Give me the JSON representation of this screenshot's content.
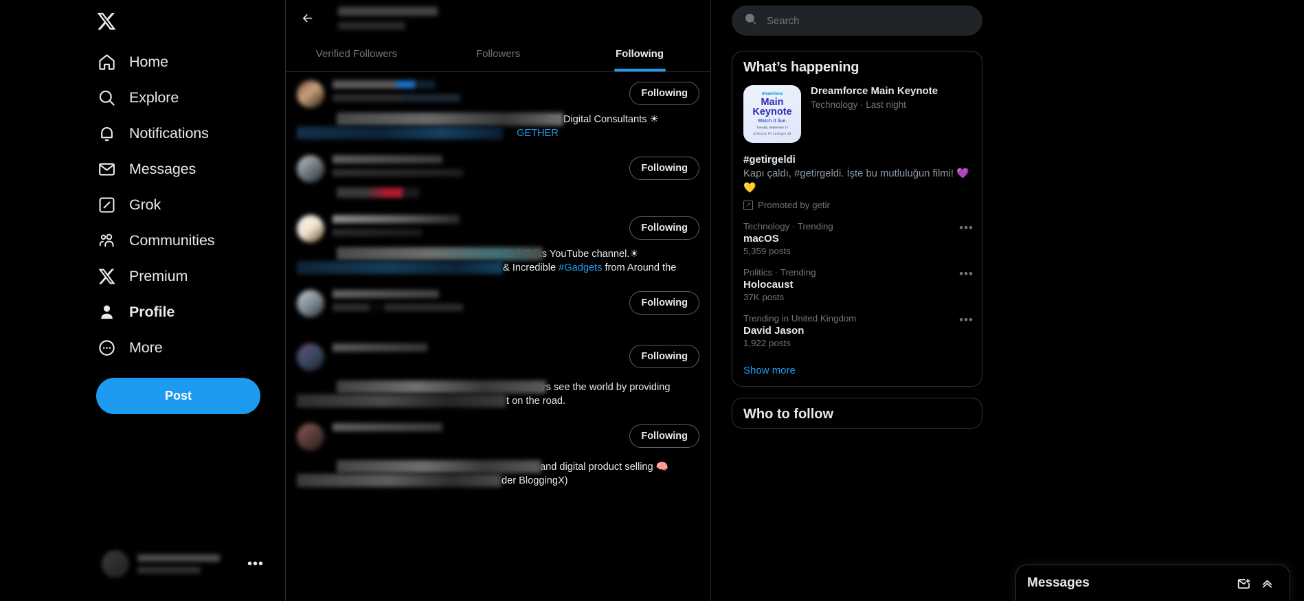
{
  "sidebar": {
    "logo_icon": "x-logo-icon",
    "items": [
      {
        "label": "Home",
        "icon": "home-icon",
        "active": false
      },
      {
        "label": "Explore",
        "icon": "search-icon",
        "active": false
      },
      {
        "label": "Notifications",
        "icon": "bell-icon",
        "active": false
      },
      {
        "label": "Messages",
        "icon": "envelope-icon",
        "active": false
      },
      {
        "label": "Grok",
        "icon": "grok-icon",
        "active": false
      },
      {
        "label": "Communities",
        "icon": "communities-icon",
        "active": false
      },
      {
        "label": "Premium",
        "icon": "x-logo-icon",
        "active": false
      },
      {
        "label": "Profile",
        "icon": "person-icon",
        "active": true
      },
      {
        "label": "More",
        "icon": "more-circle-icon",
        "active": false
      }
    ],
    "post_button": "Post",
    "account_more_icon": "ellipsis-icon"
  },
  "center": {
    "back_icon": "back-arrow-icon",
    "tabs": [
      {
        "label": "Verified Followers",
        "active": false
      },
      {
        "label": "Followers",
        "active": false
      },
      {
        "label": "Following",
        "active": true
      }
    ],
    "follow_button_label": "Following",
    "rows": [
      {
        "bio_visible": "ion - ☀ SP Digital Consultants ☀",
        "bio_visible2": "GETHER",
        "bio_mask_w": 330,
        "bio_mask_w2": 300,
        "name_w": 150,
        "handle_w": 186,
        "has_badge": true
      },
      {
        "bio_visible": "",
        "bio_visible2": "",
        "bio_mask_w": 0,
        "bio_mask_w2": 0,
        "name_w": 160,
        "handle_w": 190,
        "has_badge": false
      },
      {
        "bio_visible": " TechTalks YouTube channel.☀",
        "bio_visible2": "& Incredible #Gadgets from Around the",
        "bio_mask_w": 300,
        "bio_mask_w2": 300,
        "name_w": 185,
        "handle_w": 130,
        "has_badge": false
      },
      {
        "bio_visible": "",
        "bio_visible2": "",
        "bio_mask_w": 0,
        "bio_mask_w2": 0,
        "name_w": 155,
        "handle_w": 190,
        "has_badge": false
      },
      {
        "bio_visible": "r travelers see the world by providing",
        "bio_visible2": "t on the road.",
        "bio_mask_w": 305,
        "bio_mask_w2": 305,
        "name_w": 138,
        "handle_w": 0,
        "has_badge": false
      },
      {
        "bio_visible": "creation and digital product selling 🧠",
        "bio_visible2": "der BloggingX)",
        "bio_mask_w": 298,
        "bio_mask_w2": 298,
        "name_w": 160,
        "handle_w": 0,
        "has_badge": false
      }
    ]
  },
  "right": {
    "search": {
      "placeholder": "Search",
      "value": "",
      "icon": "search-icon"
    },
    "whats_happening": {
      "title": "What’s happening",
      "promo_card": {
        "thumb_brand": "dreamforce",
        "thumb_title_line1": "Main",
        "thumb_title_line2": "Keynote",
        "thumb_watch": "Watch it live.",
        "thumb_date1": "Tuesday, September 17",
        "thumb_date2": "10:00 a.m. PT | 1:00 p.m. ET",
        "title": "Dreamforce Main Keynote",
        "subtitle": "Technology · Last night"
      },
      "getir": {
        "hashtag": "#getirgeldi",
        "body": "Kapı çaldı, #getirgeldi. İşte bu mutluluğun filmi! 💜💛",
        "promoted_by": "Promoted by getir",
        "promoted_icon": "promoted-arrow-icon"
      },
      "trends": [
        {
          "category": "Technology · Trending",
          "name": "macOS",
          "count": "5,359 posts",
          "more_icon": "ellipsis-icon"
        },
        {
          "category": "Politics · Trending",
          "name": "Holocaust",
          "count": "37K posts",
          "more_icon": "ellipsis-icon"
        },
        {
          "category": "Trending in United Kingdom",
          "name": "David Jason",
          "count": "1,922 posts",
          "more_icon": "ellipsis-icon"
        }
      ],
      "show_more": "Show more"
    },
    "who_to_follow": {
      "title": "Who to follow"
    }
  },
  "dock": {
    "title": "Messages",
    "new_message_icon": "new-message-icon",
    "expand_icon": "chevron-up-icon"
  },
  "colors": {
    "accent": "#1d9bf0",
    "background": "#000000",
    "border": "#2f3336",
    "muted_text": "#71767b",
    "text": "#e7e9ea"
  }
}
